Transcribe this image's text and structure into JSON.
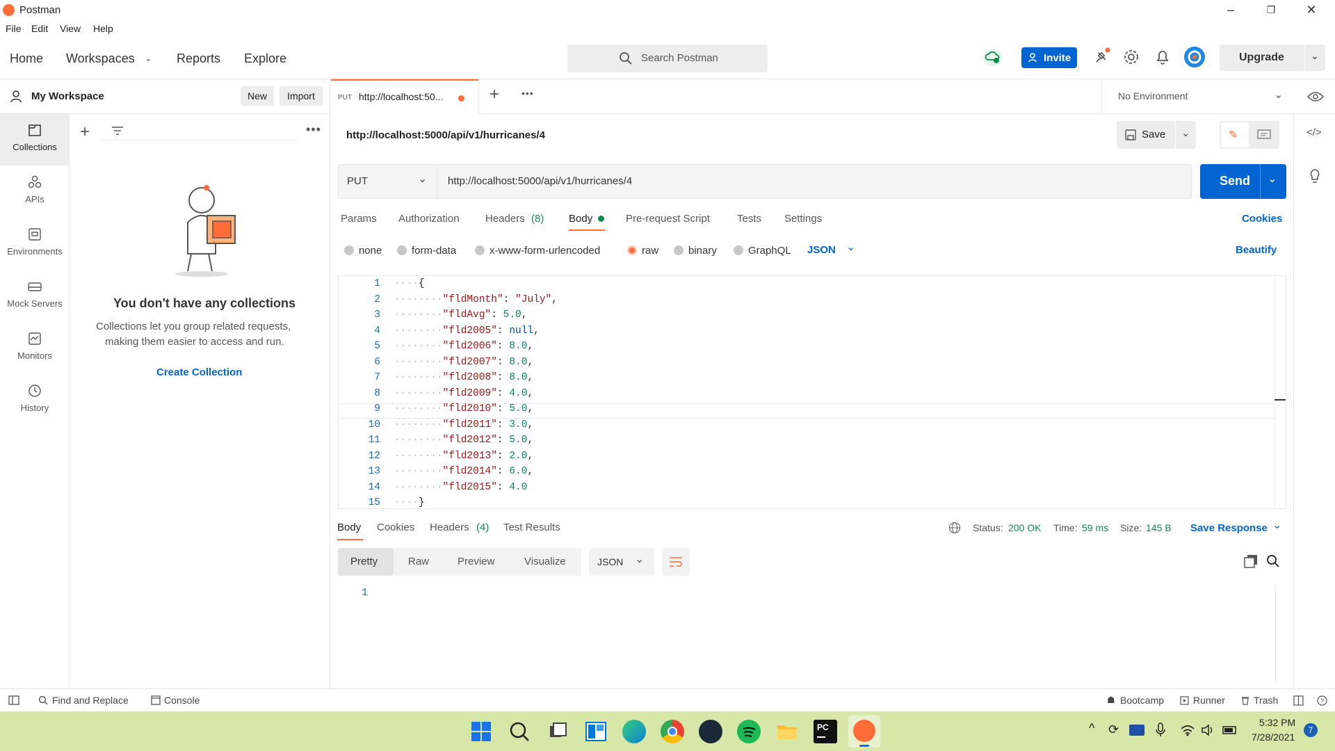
{
  "window": {
    "title": "Postman"
  },
  "menu": [
    "File",
    "Edit",
    "View",
    "Help"
  ],
  "header": {
    "nav": [
      "Home",
      "Workspaces",
      "Reports",
      "Explore"
    ],
    "search_placeholder": "Search Postman",
    "invite_label": "Invite",
    "upgrade_label": "Upgrade"
  },
  "workspace": {
    "name": "My Workspace",
    "new_label": "New",
    "import_label": "Import"
  },
  "rail": [
    "Collections",
    "APIs",
    "Environments",
    "Mock Servers",
    "Monitors",
    "History"
  ],
  "collections": {
    "empty_title": "You don't have any collections",
    "empty_text_1": "Collections let you group related requests,",
    "empty_text_2": "making them easier to access and run.",
    "create_label": "Create Collection"
  },
  "tab": {
    "method": "PUT",
    "title": "http://localhost:50..."
  },
  "environment": {
    "selected": "No Environment"
  },
  "request": {
    "name": "http://localhost:5000/api/v1/hurricanes/4",
    "save_label": "Save",
    "method": "PUT",
    "url": "http://localhost:5000/api/v1/hurricanes/4",
    "send_label": "Send"
  },
  "request_tabs": [
    "Params",
    "Authorization",
    "Headers",
    "Body",
    "Pre-request Script",
    "Tests",
    "Settings"
  ],
  "headers_count": "(8)",
  "cookies_label": "Cookies",
  "body_types": [
    "none",
    "form-data",
    "x-www-form-urlencoded",
    "raw",
    "binary",
    "GraphQL"
  ],
  "body_format": "JSON",
  "beautify_label": "Beautify",
  "code_lines": [
    {
      "n": "1",
      "key": "",
      "val": "",
      "raw": "{"
    },
    {
      "n": "2",
      "key": "\"fldMonth\"",
      "val": "\"July\","
    },
    {
      "n": "3",
      "key": "\"fldAvg\"",
      "val": "5.0,"
    },
    {
      "n": "4",
      "key": "\"fld2005\"",
      "val": "null,"
    },
    {
      "n": "5",
      "key": "\"fld2006\"",
      "val": "8.0,"
    },
    {
      "n": "6",
      "key": "\"fld2007\"",
      "val": "8.0,"
    },
    {
      "n": "7",
      "key": "\"fld2008\"",
      "val": "8.0,"
    },
    {
      "n": "8",
      "key": "\"fld2009\"",
      "val": "4.0,"
    },
    {
      "n": "9",
      "key": "\"fld2010\"",
      "val": "5.0,"
    },
    {
      "n": "10",
      "key": "\"fld2011\"",
      "val": "3.0,"
    },
    {
      "n": "11",
      "key": "\"fld2012\"",
      "val": "5.0,"
    },
    {
      "n": "12",
      "key": "\"fld2013\"",
      "val": "2.0,"
    },
    {
      "n": "13",
      "key": "\"fld2014\"",
      "val": "6.0,"
    },
    {
      "n": "14",
      "key": "\"fld2015\"",
      "val": "4.0"
    },
    {
      "n": "15",
      "key": "",
      "val": "",
      "raw": "}"
    }
  ],
  "response": {
    "tabs": [
      "Body",
      "Cookies",
      "Headers",
      "Test Results"
    ],
    "headers_count": "(4)",
    "status_label": "Status:",
    "status": "200 OK",
    "time_label": "Time:",
    "time": "59 ms",
    "size_label": "Size:",
    "size": "145 B",
    "save_label": "Save Response",
    "views": [
      "Pretty",
      "Raw",
      "Preview",
      "Visualize"
    ],
    "format": "JSON",
    "line1": "1"
  },
  "footer": {
    "find_replace": "Find and Replace",
    "console": "Console",
    "bootcamp": "Bootcamp",
    "runner": "Runner",
    "trash": "Trash"
  },
  "taskbar": {
    "time": "5:32 PM",
    "date": "7/28/2021",
    "notif": "7"
  },
  "colors": {
    "accent": "#ff6c37",
    "blue": "#0265d2",
    "ok": "#0f8a4f"
  }
}
